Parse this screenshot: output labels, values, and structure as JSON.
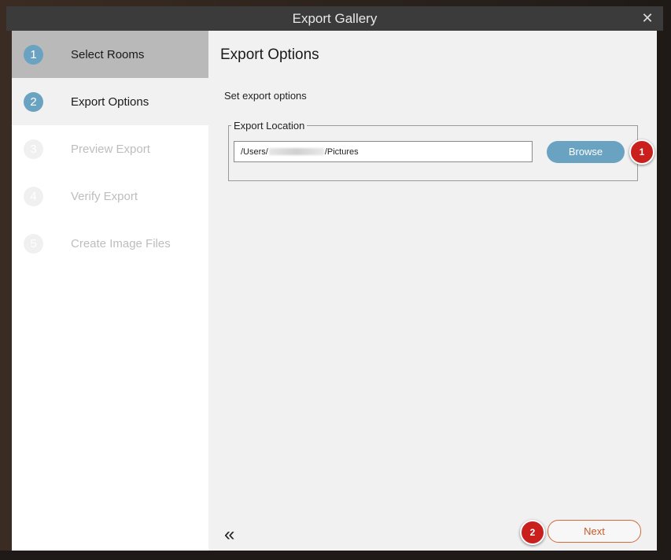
{
  "window": {
    "title": "Export Gallery"
  },
  "steps": [
    {
      "num": "1",
      "label": "Select Rooms"
    },
    {
      "num": "2",
      "label": "Export Options"
    },
    {
      "num": "3",
      "label": "Preview Export"
    },
    {
      "num": "4",
      "label": "Verify Export"
    },
    {
      "num": "5",
      "label": "Create Image Files"
    }
  ],
  "main": {
    "title": "Export Options",
    "subtitle": "Set export options",
    "location_legend": "Export Location",
    "path_prefix": "/Users/",
    "path_suffix": "/Pictures",
    "browse_label": "Browse",
    "next_label": "Next"
  },
  "annotations": {
    "badge1": "1",
    "badge2": "2"
  },
  "icons": {
    "close": "close-icon",
    "collapse": "double-chevron-left-icon"
  },
  "colors": {
    "accent": "#6aa3c2",
    "next_border": "#d06a3a",
    "badge": "#c9201e"
  }
}
